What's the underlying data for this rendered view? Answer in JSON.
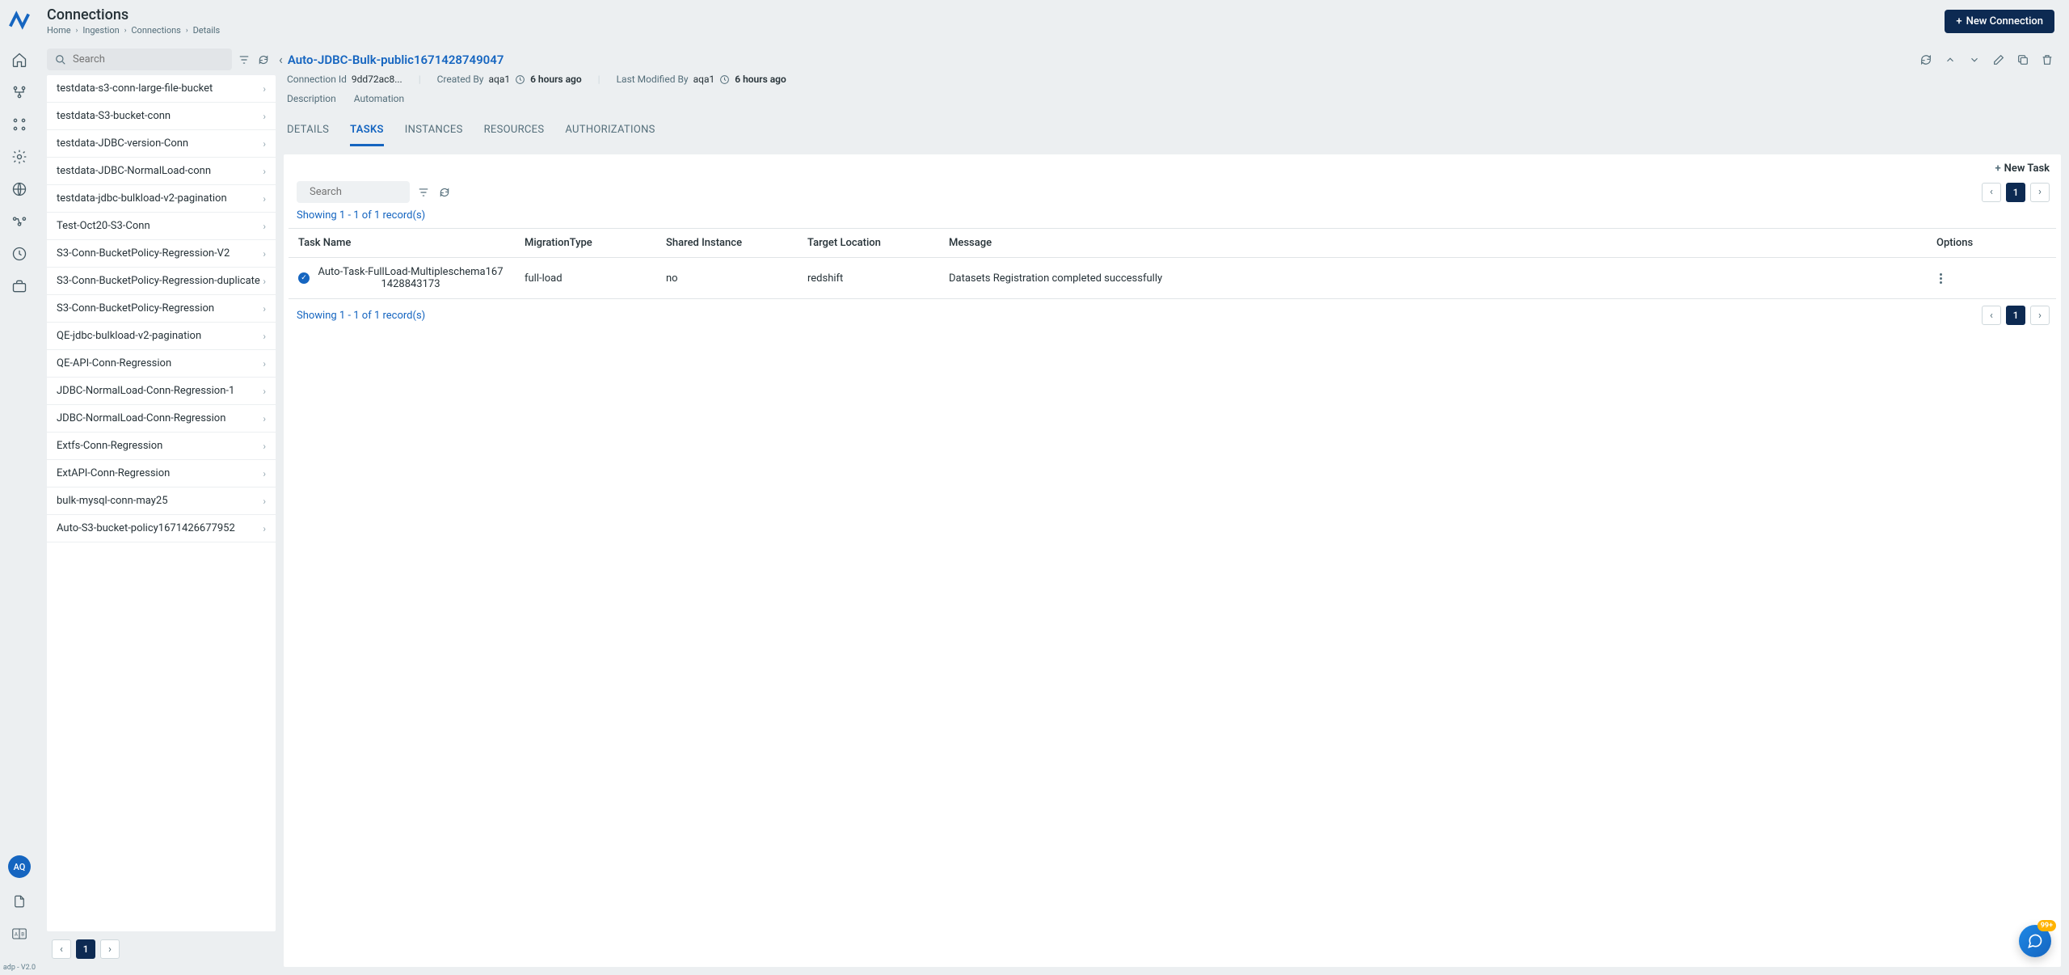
{
  "header": {
    "title": "Connections",
    "breadcrumb": [
      "Home",
      "Ingestion",
      "Connections",
      "Details"
    ],
    "new_connection_label": "New Connection"
  },
  "nav": {
    "avatar_initials": "AQ",
    "version": "adp - V2.0"
  },
  "sidebar": {
    "search_placeholder": "Search",
    "items": [
      "testdata-s3-conn-large-file-bucket",
      "testdata-S3-bucket-conn",
      "testdata-JDBC-version-Conn",
      "testdata-JDBC-NormalLoad-conn",
      "testdata-jdbc-bulkload-v2-pagination",
      "Test-Oct20-S3-Conn",
      "S3-Conn-BucketPolicy-Regression-V2",
      "S3-Conn-BucketPolicy-Regression-duplicate",
      "S3-Conn-BucketPolicy-Regression",
      "QE-jdbc-bulkload-v2-pagination",
      "QE-API-Conn-Regression",
      "JDBC-NormalLoad-Conn-Regression-1",
      "JDBC-NormalLoad-Conn-Regression",
      "Extfs-Conn-Regression",
      "ExtAPI-Conn-Regression",
      "bulk-mysql-conn-may25",
      "Auto-S3-bucket-policy1671426677952"
    ],
    "page": "1"
  },
  "detail": {
    "title": "Auto-JDBC-Bulk-public1671428749047",
    "connection_id_label": "Connection Id",
    "connection_id_value": "9dd72ac8...",
    "created_by_label": "Created By",
    "created_by_value": "aqa1",
    "created_time": "6 hours ago",
    "modified_by_label": "Last Modified By",
    "modified_by_value": "aqa1",
    "modified_time": "6 hours ago",
    "description_label": "Description",
    "automation_label": "Automation",
    "tabs": [
      "DETAILS",
      "TASKS",
      "INSTANCES",
      "RESOURCES",
      "AUTHORIZATIONS"
    ],
    "active_tab": "TASKS"
  },
  "tasks": {
    "search_placeholder": "Search",
    "new_task_label": "New Task",
    "showing": "Showing 1 - 1 of 1 record(s)",
    "page": "1",
    "columns": [
      "Task Name",
      "MigrationType",
      "Shared Instance",
      "Target Location",
      "Message",
      "Options"
    ],
    "rows": [
      {
        "name": "Auto-Task-FullLoad-Multipleschema1671428843173",
        "migration_type": "full-load",
        "shared_instance": "no",
        "target_location": "redshift",
        "message": "Datasets Registration completed successfully"
      }
    ]
  },
  "chat": {
    "badge": "99+"
  }
}
